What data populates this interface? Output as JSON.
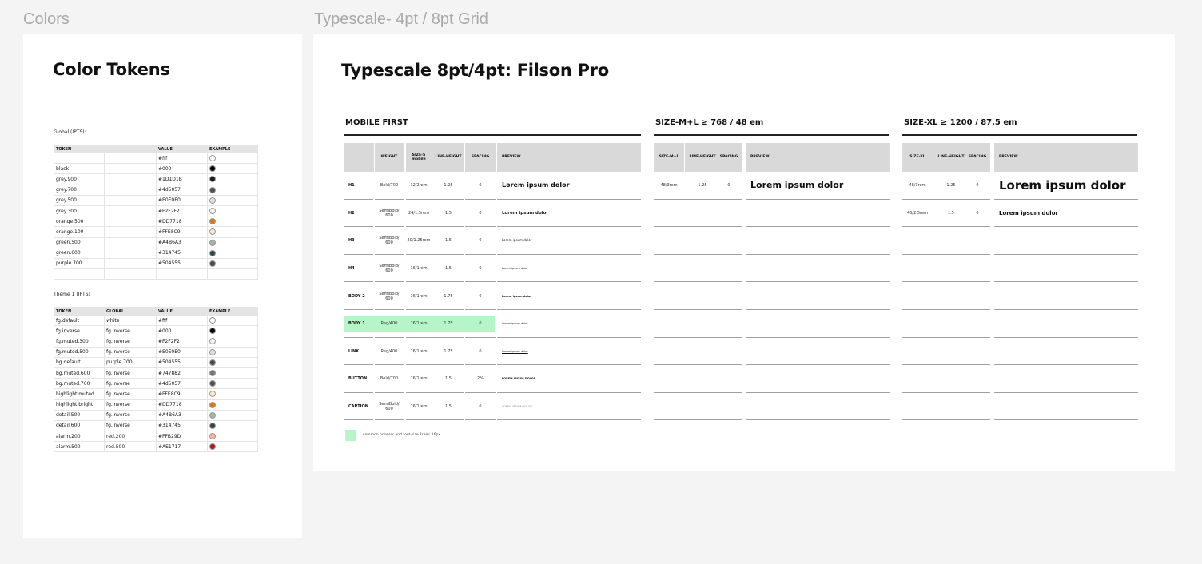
{
  "frames": {
    "colors_label": "Colors",
    "type_label": "Typescale- 4pt / 8pt Grid"
  },
  "colors": {
    "title": "Color Tokens",
    "global_label": "Global (IPTS):",
    "theme_label": "Theme 1 (IPTS)",
    "global_headers": [
      "TOKEN",
      "",
      "VALUE",
      "EXAMPLE"
    ],
    "global_rows": [
      {
        "token": "",
        "global": "",
        "value": "#fff",
        "color": "#ffffff"
      },
      {
        "token": "black",
        "global": "",
        "value": "#000",
        "color": "#000000"
      },
      {
        "token": "grey.900",
        "global": "",
        "value": "#1D1D1B",
        "color": "#1D1D1B"
      },
      {
        "token": "grey.700",
        "global": "",
        "value": "#4d5057",
        "color": "#4d5057"
      },
      {
        "token": "grey.500",
        "global": "",
        "value": "#E0E0E0",
        "color": "#E0E0E0"
      },
      {
        "token": "grey.300",
        "global": "",
        "value": "#F2F2F2",
        "color": "#F2F2F2"
      },
      {
        "token": "orange.500",
        "global": "",
        "value": "#DD7718",
        "color": "#DD7718"
      },
      {
        "token": "orange.100",
        "global": "",
        "value": "#FFE8C9",
        "color": "#FFE8C9"
      },
      {
        "token": "green.500",
        "global": "",
        "value": "#A4B6A3",
        "color": "#A4B6A3"
      },
      {
        "token": "green.600",
        "global": "",
        "value": "#314745",
        "color": "#314745"
      },
      {
        "token": "purple.700",
        "global": "",
        "value": "#504555",
        "color": "#504555"
      },
      {
        "token": "",
        "global": "",
        "value": "",
        "color": ""
      }
    ],
    "theme_headers": [
      "TOKEN",
      "GLOBAL",
      "VALUE",
      "EXAMPLE"
    ],
    "theme_rows": [
      {
        "token": "fg.default",
        "global": "white",
        "value": "#fff",
        "color": "#ffffff"
      },
      {
        "token": "fg.inverse",
        "global": "fg.inverse",
        "value": "#000",
        "color": "#000000"
      },
      {
        "token": "fg.muted.300",
        "global": "fg.inverse",
        "value": "#F2F2F2",
        "color": "#F2F2F2"
      },
      {
        "token": "fg.muted.500",
        "global": "fg.inverse",
        "value": "#E0E0E0",
        "color": "#E0E0E0"
      },
      {
        "token": "bg.default",
        "global": "purple.700",
        "value": "#504555",
        "color": "#504555"
      },
      {
        "token": "bg.muted.600",
        "global": "fg.inverse",
        "value": "#747882",
        "color": "#747882"
      },
      {
        "token": "bg.muted.700",
        "global": "fg.inverse",
        "value": "#4d5057",
        "color": "#4d5057"
      },
      {
        "token": "highlight.muted",
        "global": "fg.inverse",
        "value": "#FFE8C9",
        "color": "#FFE8C9"
      },
      {
        "token": "highlight.bright",
        "global": "fg.inverse",
        "value": "#DD7718",
        "color": "#DD7718"
      },
      {
        "token": "detail.500",
        "global": "fg.inverse",
        "value": "#A4B6A3",
        "color": "#A4B6A3"
      },
      {
        "token": "detail.600",
        "global": "fg.inverse",
        "value": "#314745",
        "color": "#314745"
      },
      {
        "token": "alarm.200",
        "global": "red.200",
        "value": "#FFB29D",
        "color": "#FFB29D"
      },
      {
        "token": "alarm.500",
        "global": "red.500",
        "value": "#AE1717",
        "color": "#AE1717"
      }
    ]
  },
  "typescale": {
    "title": "Typescale 8pt/4pt:  Filson Pro",
    "mobile_header": "MOBILE FIRST",
    "ml_header": "SIZE-M+L ≥ 768 / 48 em",
    "xl_header": "SIZE-XL ≥ 1200 / 87.5 em",
    "mobile_cols": [
      "",
      "WEIGHT",
      "SIZE-S mobile",
      "LINE-HEIGHT",
      "SPACING",
      "PREVIEW"
    ],
    "ml_cols": [
      "SIZE-M+L",
      "LINE-HEIGHT",
      "SPACING",
      "PREVIEW"
    ],
    "xl_cols": [
      "SIZE-XL",
      "LINE-HEIGHT",
      "SPACING",
      "PREVIEW"
    ],
    "rows": [
      {
        "name": "H1",
        "weight": "Bold/700",
        "size": "32/2rem",
        "lh": "1.25",
        "sp": "0",
        "preview": "Lorem ipsum dolor",
        "ml_size": "48/3rem",
        "ml_lh": "1.25",
        "ml_sp": "0",
        "ml_preview": "Lorem ipsum dolor",
        "xl_size": "48/3rem",
        "xl_lh": "1.25",
        "xl_sp": "0",
        "xl_preview": "Lorem ipsum dolor"
      },
      {
        "name": "H2",
        "weight": "SemiBold/ 600",
        "size": "24/1.5rem",
        "lh": "1.5",
        "sp": "0",
        "preview": "Lorem ipsum dolor",
        "ml_size": "",
        "ml_lh": "",
        "ml_sp": "",
        "ml_preview": "",
        "xl_size": "40/2.5rem",
        "xl_lh": "1.5",
        "xl_sp": "0",
        "xl_preview": "Lorem ipsum dolor"
      },
      {
        "name": "H3",
        "weight": "SemiBold/ 600",
        "size": "20/1.25rem",
        "lh": "1.5",
        "sp": "0",
        "preview": "Lorem ipsum dolor",
        "ml_size": "",
        "ml_lh": "",
        "ml_sp": "",
        "ml_preview": "",
        "xl_size": "",
        "xl_lh": "",
        "xl_sp": "",
        "xl_preview": ""
      },
      {
        "name": "H4",
        "weight": "SemiBold/ 600",
        "size": "16/1rem",
        "lh": "1.5",
        "sp": "0",
        "preview": "Lorem ipsum dolor",
        "ml_size": "",
        "ml_lh": "",
        "ml_sp": "",
        "ml_preview": "",
        "xl_size": "",
        "xl_lh": "",
        "xl_sp": "",
        "xl_preview": ""
      },
      {
        "name": "BODY 2",
        "weight": "SemiBold/ 600",
        "size": "16/1rem",
        "lh": "1.75",
        "sp": "0",
        "preview": "Lorem ipsum dolor",
        "ml_size": "",
        "ml_lh": "",
        "ml_sp": "",
        "ml_preview": "",
        "xl_size": "",
        "xl_lh": "",
        "xl_sp": "",
        "xl_preview": ""
      },
      {
        "name": "BODY 1",
        "weight": "Reg/400",
        "size": "16/1rem",
        "lh": "1.75",
        "sp": "0",
        "preview": "Lorem ipsum dolor",
        "ml_size": "",
        "ml_lh": "",
        "ml_sp": "",
        "ml_preview": "",
        "xl_size": "",
        "xl_lh": "",
        "xl_sp": "",
        "xl_preview": ""
      },
      {
        "name": "LINK",
        "weight": "Reg/400",
        "size": "16/1rem",
        "lh": "1.75",
        "sp": "0",
        "preview": "Lorem ipsum dolor",
        "ml_size": "",
        "ml_lh": "",
        "ml_sp": "",
        "ml_preview": "",
        "xl_size": "",
        "xl_lh": "",
        "xl_sp": "",
        "xl_preview": ""
      },
      {
        "name": "BUTTON",
        "weight": "Bold/700",
        "size": "16/1rem",
        "lh": "1.5",
        "sp": "2%",
        "preview": "LOREM IPSUM DOLOR",
        "ml_size": "",
        "ml_lh": "",
        "ml_sp": "",
        "ml_preview": "",
        "xl_size": "",
        "xl_lh": "",
        "xl_sp": "",
        "xl_preview": ""
      },
      {
        "name": "CAPTION",
        "weight": "SemiBold/ 600",
        "size": "16/1rem",
        "lh": "1.5",
        "sp": "0",
        "preview": "LOREM IPSUM DOLOR",
        "ml_size": "",
        "ml_lh": "",
        "ml_sp": "",
        "ml_preview": "",
        "xl_size": "",
        "xl_lh": "",
        "xl_sp": "",
        "xl_preview": ""
      }
    ],
    "highlight_row": 5,
    "highlight_color": "#b6f5c8",
    "legend_text": "common browser and font-size 1rem: 16px"
  }
}
